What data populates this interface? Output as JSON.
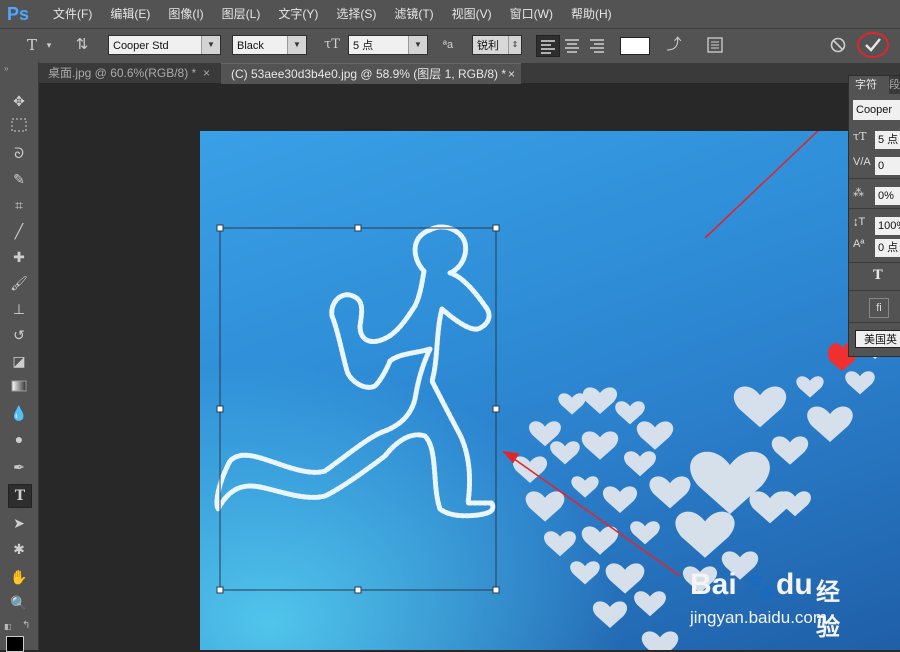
{
  "app": {
    "logo": "Ps"
  },
  "menu": [
    "文件(F)",
    "编辑(E)",
    "图像(I)",
    "图层(L)",
    "文字(Y)",
    "选择(S)",
    "滤镜(T)",
    "视图(V)",
    "窗口(W)",
    "帮助(H)"
  ],
  "options": {
    "font_family": "Cooper Std",
    "font_style": "Black",
    "font_size": "5 点",
    "aa_icon": "ªa",
    "antialias": "锐利",
    "text_color": "#ffffff"
  },
  "tabs": [
    {
      "label": "桌面.jpg @ 60.6%(RGB/8) *",
      "active": false
    },
    {
      "label": "(C) 53aee30d3b4e0.jpg @ 58.9% (图层 1, RGB/8) *",
      "active": true
    }
  ],
  "char_panel": {
    "tab_label": "字符",
    "tab2_label": "段",
    "font": "Cooper",
    "size": "5 点",
    "tracking": "0",
    "scale": "0%",
    "vscale": "100%",
    "baseline": "0 点",
    "language": "美国英"
  },
  "watermark": {
    "brand": "Bai",
    "brand2": "du",
    "suffix": "经验",
    "url": "jingyan.baidu.com"
  },
  "colors": {
    "accent": "#e0262c",
    "workspace": "#282828",
    "chrome": "#535353"
  }
}
